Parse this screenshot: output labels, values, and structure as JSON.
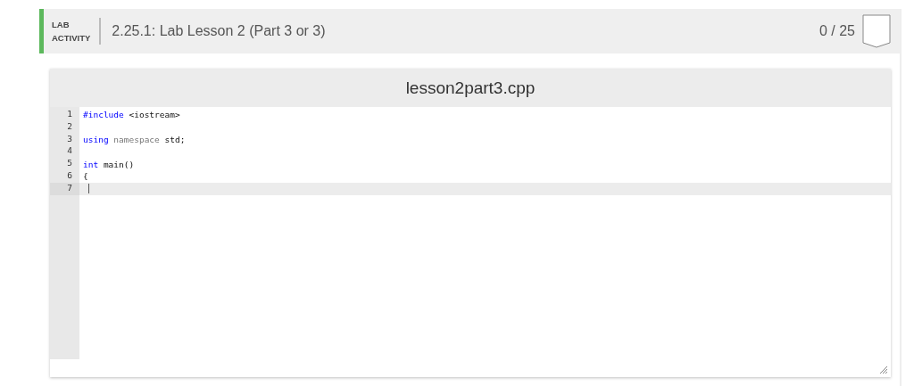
{
  "header": {
    "badge_lines": [
      "LAB",
      "ACTIVITY"
    ],
    "title": "2.25.1: Lab Lesson 2 (Part 3 or 3)",
    "score": "0 / 25"
  },
  "editor": {
    "filename": "lesson2part3.cpp",
    "lines": [
      {
        "number": "1",
        "current": false,
        "tokens": [
          {
            "text": "#include",
            "kind": "keyword"
          },
          {
            "text": " <iostream>",
            "kind": "plain"
          }
        ]
      },
      {
        "number": "2",
        "current": false
      },
      {
        "number": "3",
        "current": false,
        "tokens": [
          {
            "text": "using",
            "kind": "keyword"
          },
          {
            "text": " namespace",
            "kind": "muted"
          },
          {
            "text": " std;",
            "kind": "plain"
          }
        ]
      },
      {
        "number": "4",
        "current": false
      },
      {
        "number": "5",
        "current": false,
        "tokens": [
          {
            "text": "int",
            "kind": "keyword"
          },
          {
            "text": " main()",
            "kind": "plain"
          }
        ]
      },
      {
        "number": "6",
        "current": false,
        "tokens": [
          {
            "text": "{",
            "kind": "plain"
          }
        ]
      },
      {
        "number": "7",
        "current": true
      }
    ]
  }
}
